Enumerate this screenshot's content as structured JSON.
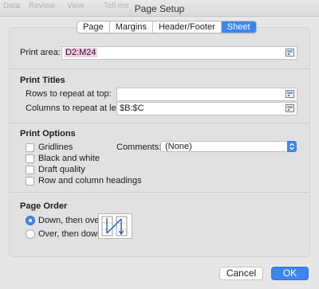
{
  "window": {
    "title": "Page Setup",
    "background_menu": [
      "Data",
      "Review",
      "View",
      "Tell me"
    ]
  },
  "tabs": [
    {
      "label": "Page",
      "active": false
    },
    {
      "label": "Margins",
      "active": false
    },
    {
      "label": "Header/Footer",
      "active": false
    },
    {
      "label": "Sheet",
      "active": true
    }
  ],
  "print_area": {
    "label": "Print area:",
    "value": "D2:M24"
  },
  "print_titles": {
    "heading": "Print Titles",
    "rows_label": "Rows to repeat at top:",
    "rows_value": "",
    "columns_label": "Columns to repeat at left:",
    "columns_value": "$B:$C"
  },
  "print_options": {
    "heading": "Print Options",
    "gridlines": {
      "label": "Gridlines",
      "checked": false
    },
    "black_and_white": {
      "label": "Black and white",
      "checked": false
    },
    "draft_quality": {
      "label": "Draft quality",
      "checked": false
    },
    "row_column_headings": {
      "label": "Row and column headings",
      "checked": false
    },
    "comments_label": "Comments:",
    "comments_value": "(None)"
  },
  "page_order": {
    "heading": "Page Order",
    "down_then_over": {
      "label": "Down, then over",
      "selected": true
    },
    "over_then_down": {
      "label": "Over, then down",
      "selected": false
    }
  },
  "buttons": {
    "cancel": "Cancel",
    "ok": "OK"
  },
  "colors": {
    "accent": "#3b86f0",
    "highlight": "#f5cde8"
  }
}
